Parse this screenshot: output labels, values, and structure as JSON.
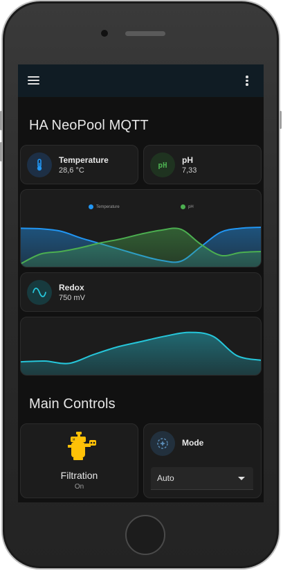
{
  "app": {
    "title": "HA NeoPool MQTT",
    "menu_icon": "hamburger-menu-icon",
    "overflow_icon": "vertical-dots-icon",
    "background": "#111111",
    "appbar_color": "#101c24"
  },
  "sensors": {
    "temperature": {
      "name": "Temperature",
      "state": "28,6 °C",
      "icon": "thermometer-icon",
      "color": "#2196f3"
    },
    "ph": {
      "name": "pH",
      "state": "7,33",
      "icon": "ph-icon",
      "icon_text": "pH",
      "color": "#4caf50"
    },
    "redox": {
      "name": "Redox",
      "state": "750 mV",
      "icon": "sine-wave-icon",
      "color": "#26c6da"
    }
  },
  "chart_data": [
    {
      "type": "area",
      "x": [
        0,
        1,
        2,
        3,
        4,
        5,
        6,
        7,
        8,
        9,
        10,
        11,
        12
      ],
      "series": [
        {
          "name": "Temperature",
          "color": "#2196f3",
          "values": [
            0.78,
            0.77,
            0.72,
            0.58,
            0.46,
            0.34,
            0.22,
            0.12,
            0.1,
            0.4,
            0.7,
            0.78,
            0.8
          ]
        },
        {
          "name": "pH",
          "color": "#4caf50",
          "values": [
            0.05,
            0.25,
            0.3,
            0.38,
            0.48,
            0.56,
            0.66,
            0.74,
            0.76,
            0.45,
            0.22,
            0.28,
            0.3
          ]
        }
      ],
      "legend": "top",
      "ylim": [
        0,
        1
      ]
    },
    {
      "type": "area",
      "x": [
        0,
        1,
        2,
        3,
        4,
        5,
        6,
        7,
        8,
        9,
        10
      ],
      "series": [
        {
          "name": "Redox",
          "color": "#26c6da",
          "values": [
            0.14,
            0.16,
            0.1,
            0.32,
            0.52,
            0.66,
            0.8,
            0.9,
            0.8,
            0.3,
            0.18
          ]
        }
      ],
      "legend": "none",
      "ylim": [
        0,
        1
      ]
    }
  ],
  "controls": {
    "title": "Main Controls",
    "filtration": {
      "name": "Filtration",
      "state": "On",
      "icon": "pool-pump-icon",
      "color": "#ffc107"
    },
    "mode": {
      "name": "Mode",
      "icon": "pump-mode-icon",
      "selected": "Auto",
      "dropdown_icon": "chevron-down-icon"
    }
  }
}
